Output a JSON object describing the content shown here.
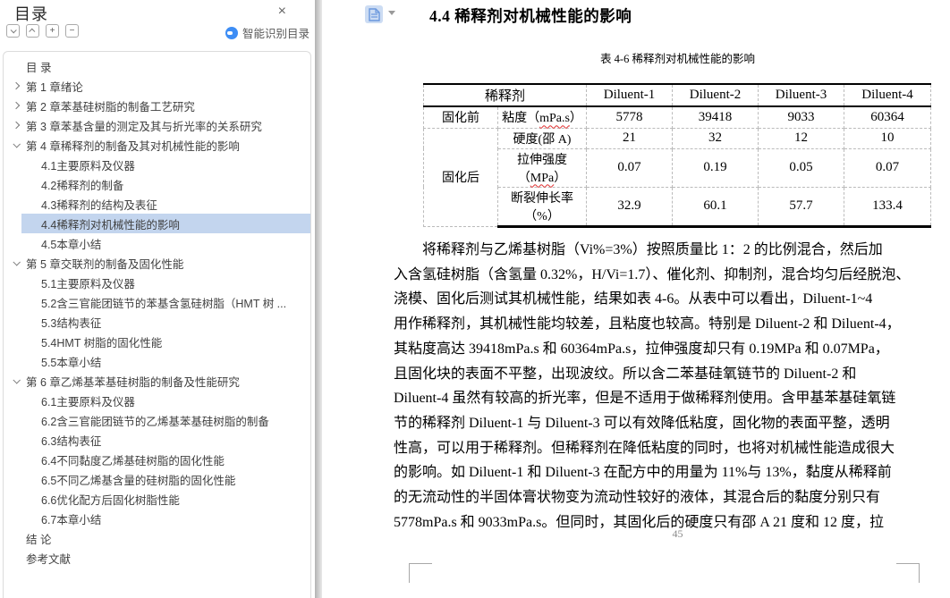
{
  "colors": {
    "accent_blue": "#3d8df5",
    "toc_active_bg": "#c3d5ee",
    "squiggle_red": "#e03030"
  },
  "sidebar": {
    "title": "目录",
    "close_icon": "close-icon",
    "toolbar_icons": [
      "chevron-down-box",
      "chevron-up-box",
      "plus-box",
      "minus-box"
    ],
    "plus_glyph": "+",
    "minus_glyph": "−",
    "smart_toc_label": "智能识别目录",
    "items": [
      {
        "label": "目 录",
        "type": "root",
        "active": false
      },
      {
        "label": "第 1 章绪论",
        "type": "chapter",
        "expanded": false,
        "active": false
      },
      {
        "label": "第 2 章苯基硅树脂的制备工艺研究",
        "type": "chapter",
        "expanded": false,
        "active": false
      },
      {
        "label": "第 3 章苯基含量的测定及其与折光率的关系研究",
        "type": "chapter",
        "expanded": false,
        "active": false
      },
      {
        "label": "第 4 章稀释剂的制备及其对机械性能的影响",
        "type": "chapter",
        "expanded": true,
        "active": false
      },
      {
        "label": "4.1主要原料及仪器",
        "type": "section",
        "active": false
      },
      {
        "label": "4.2稀释剂的制备",
        "type": "section",
        "active": false
      },
      {
        "label": "4.3稀释剂的结构及表征",
        "type": "section",
        "active": false
      },
      {
        "label": "4.4稀释剂对机械性能的影响",
        "type": "section",
        "active": true
      },
      {
        "label": "4.5本章小结",
        "type": "section",
        "active": false
      },
      {
        "label": "第 5 章交联剂的制备及固化性能",
        "type": "chapter",
        "expanded": true,
        "active": false
      },
      {
        "label": "5.1主要原料及仪器",
        "type": "section",
        "active": false
      },
      {
        "label": "5.2含三官能团链节的苯基含氢硅树脂（HMT 树 ...",
        "type": "section",
        "active": false
      },
      {
        "label": "5.3结构表征",
        "type": "section",
        "active": false
      },
      {
        "label": "5.4HMT 树脂的固化性能",
        "type": "section",
        "active": false
      },
      {
        "label": "5.5本章小结",
        "type": "section",
        "active": false
      },
      {
        "label": "第 6 章乙烯基苯基硅树脂的制备及性能研究",
        "type": "chapter",
        "expanded": true,
        "active": false
      },
      {
        "label": "6.1主要原料及仪器",
        "type": "section",
        "active": false
      },
      {
        "label": "6.2含三官能团链节的乙烯基苯基硅树脂的制备",
        "type": "section",
        "active": false
      },
      {
        "label": "6.3结构表征",
        "type": "section",
        "active": false
      },
      {
        "label": "6.4不同黏度乙烯基硅树脂的固化性能",
        "type": "section",
        "active": false
      },
      {
        "label": "6.5不同乙烯基含量的硅树脂的固化性能",
        "type": "section",
        "active": false
      },
      {
        "label": "6.6优化配方后固化树脂性能",
        "type": "section",
        "active": false
      },
      {
        "label": "6.7本章小结",
        "type": "section",
        "active": false
      },
      {
        "label": "结 论",
        "type": "root",
        "active": false
      },
      {
        "label": "参考文献",
        "type": "root",
        "active": false
      }
    ]
  },
  "content": {
    "heading": "4.4 稀释剂对机械性能的影响",
    "table": {
      "caption": "表 4-6 稀释剂对机械性能的影响",
      "corner_header": "稀释剂",
      "col_headers": [
        "Diluent-1",
        "Diluent-2",
        "Diluent-3",
        "Diluent-4"
      ],
      "rows": [
        {
          "stage": "固化前",
          "prop_pre": "粘度（",
          "prop_unit": "mPa.s",
          "prop_post": "）",
          "values": [
            "5778",
            "39418",
            "9033",
            "60364"
          ]
        },
        {
          "stage": "固化后",
          "prop": "硬度(邵 A)",
          "values": [
            "21",
            "32",
            "12",
            "10"
          ]
        },
        {
          "prop_line1": "拉伸强度",
          "prop_pre": "（",
          "prop_unit": "MPa",
          "prop_post": "）",
          "values": [
            "0.07",
            "0.19",
            "0.05",
            "0.07"
          ]
        },
        {
          "prop_line1": "断裂伸长率",
          "prop_line2": "（%）",
          "values": [
            "32.9",
            "60.1",
            "57.7",
            "133.4"
          ]
        }
      ]
    },
    "paragraph_lines": [
      "将稀释剂与乙烯基树脂（Vi%=3%）按照质量比 1：2 的比例混合，然后加",
      "入含氢硅树脂（含氢量 0.32%，H/Vi=1.7）、催化剂、抑制剂，混合均匀后经脱泡、",
      "浇模、固化后测试其机械性能，结果如表 4-6。从表中可以看出，Diluent-1~4",
      "用作稀释剂，其机械性能均较差，且粘度也较高。特别是 Diluent-2 和 Diluent-4，",
      "其粘度高达 39418mPa.s 和 60364mPa.s，拉伸强度却只有 0.19MPa 和 0.07MPa，",
      "且固化块的表面不平整，出现波纹。所以含二苯基硅氧链节的 Diluent-2 和",
      "Diluent-4 虽然有较高的折光率，但是不适用于做稀释剂使用。含甲基苯基硅氧链",
      "节的稀释剂 Diluent-1 与 Diluent-3 可以有效降低粘度，固化物的表面平整，透明",
      "性高，可以用于稀释剂。但稀释剂在降低粘度的同时，也将对机械性能造成很大",
      "的影响。如 Diluent-1 和 Diluent-3 在配方中的用量为 11%与 13%，黏度从稀释前",
      "的无流动性的半固体膏状物变为流动性较好的液体，其混合后的黏度分别只有",
      "5778mPa.s 和 9033mPa.s。但同时，其固化后的硬度只有邵 A 21 度和 12 度，拉"
    ],
    "page_number": "45"
  }
}
